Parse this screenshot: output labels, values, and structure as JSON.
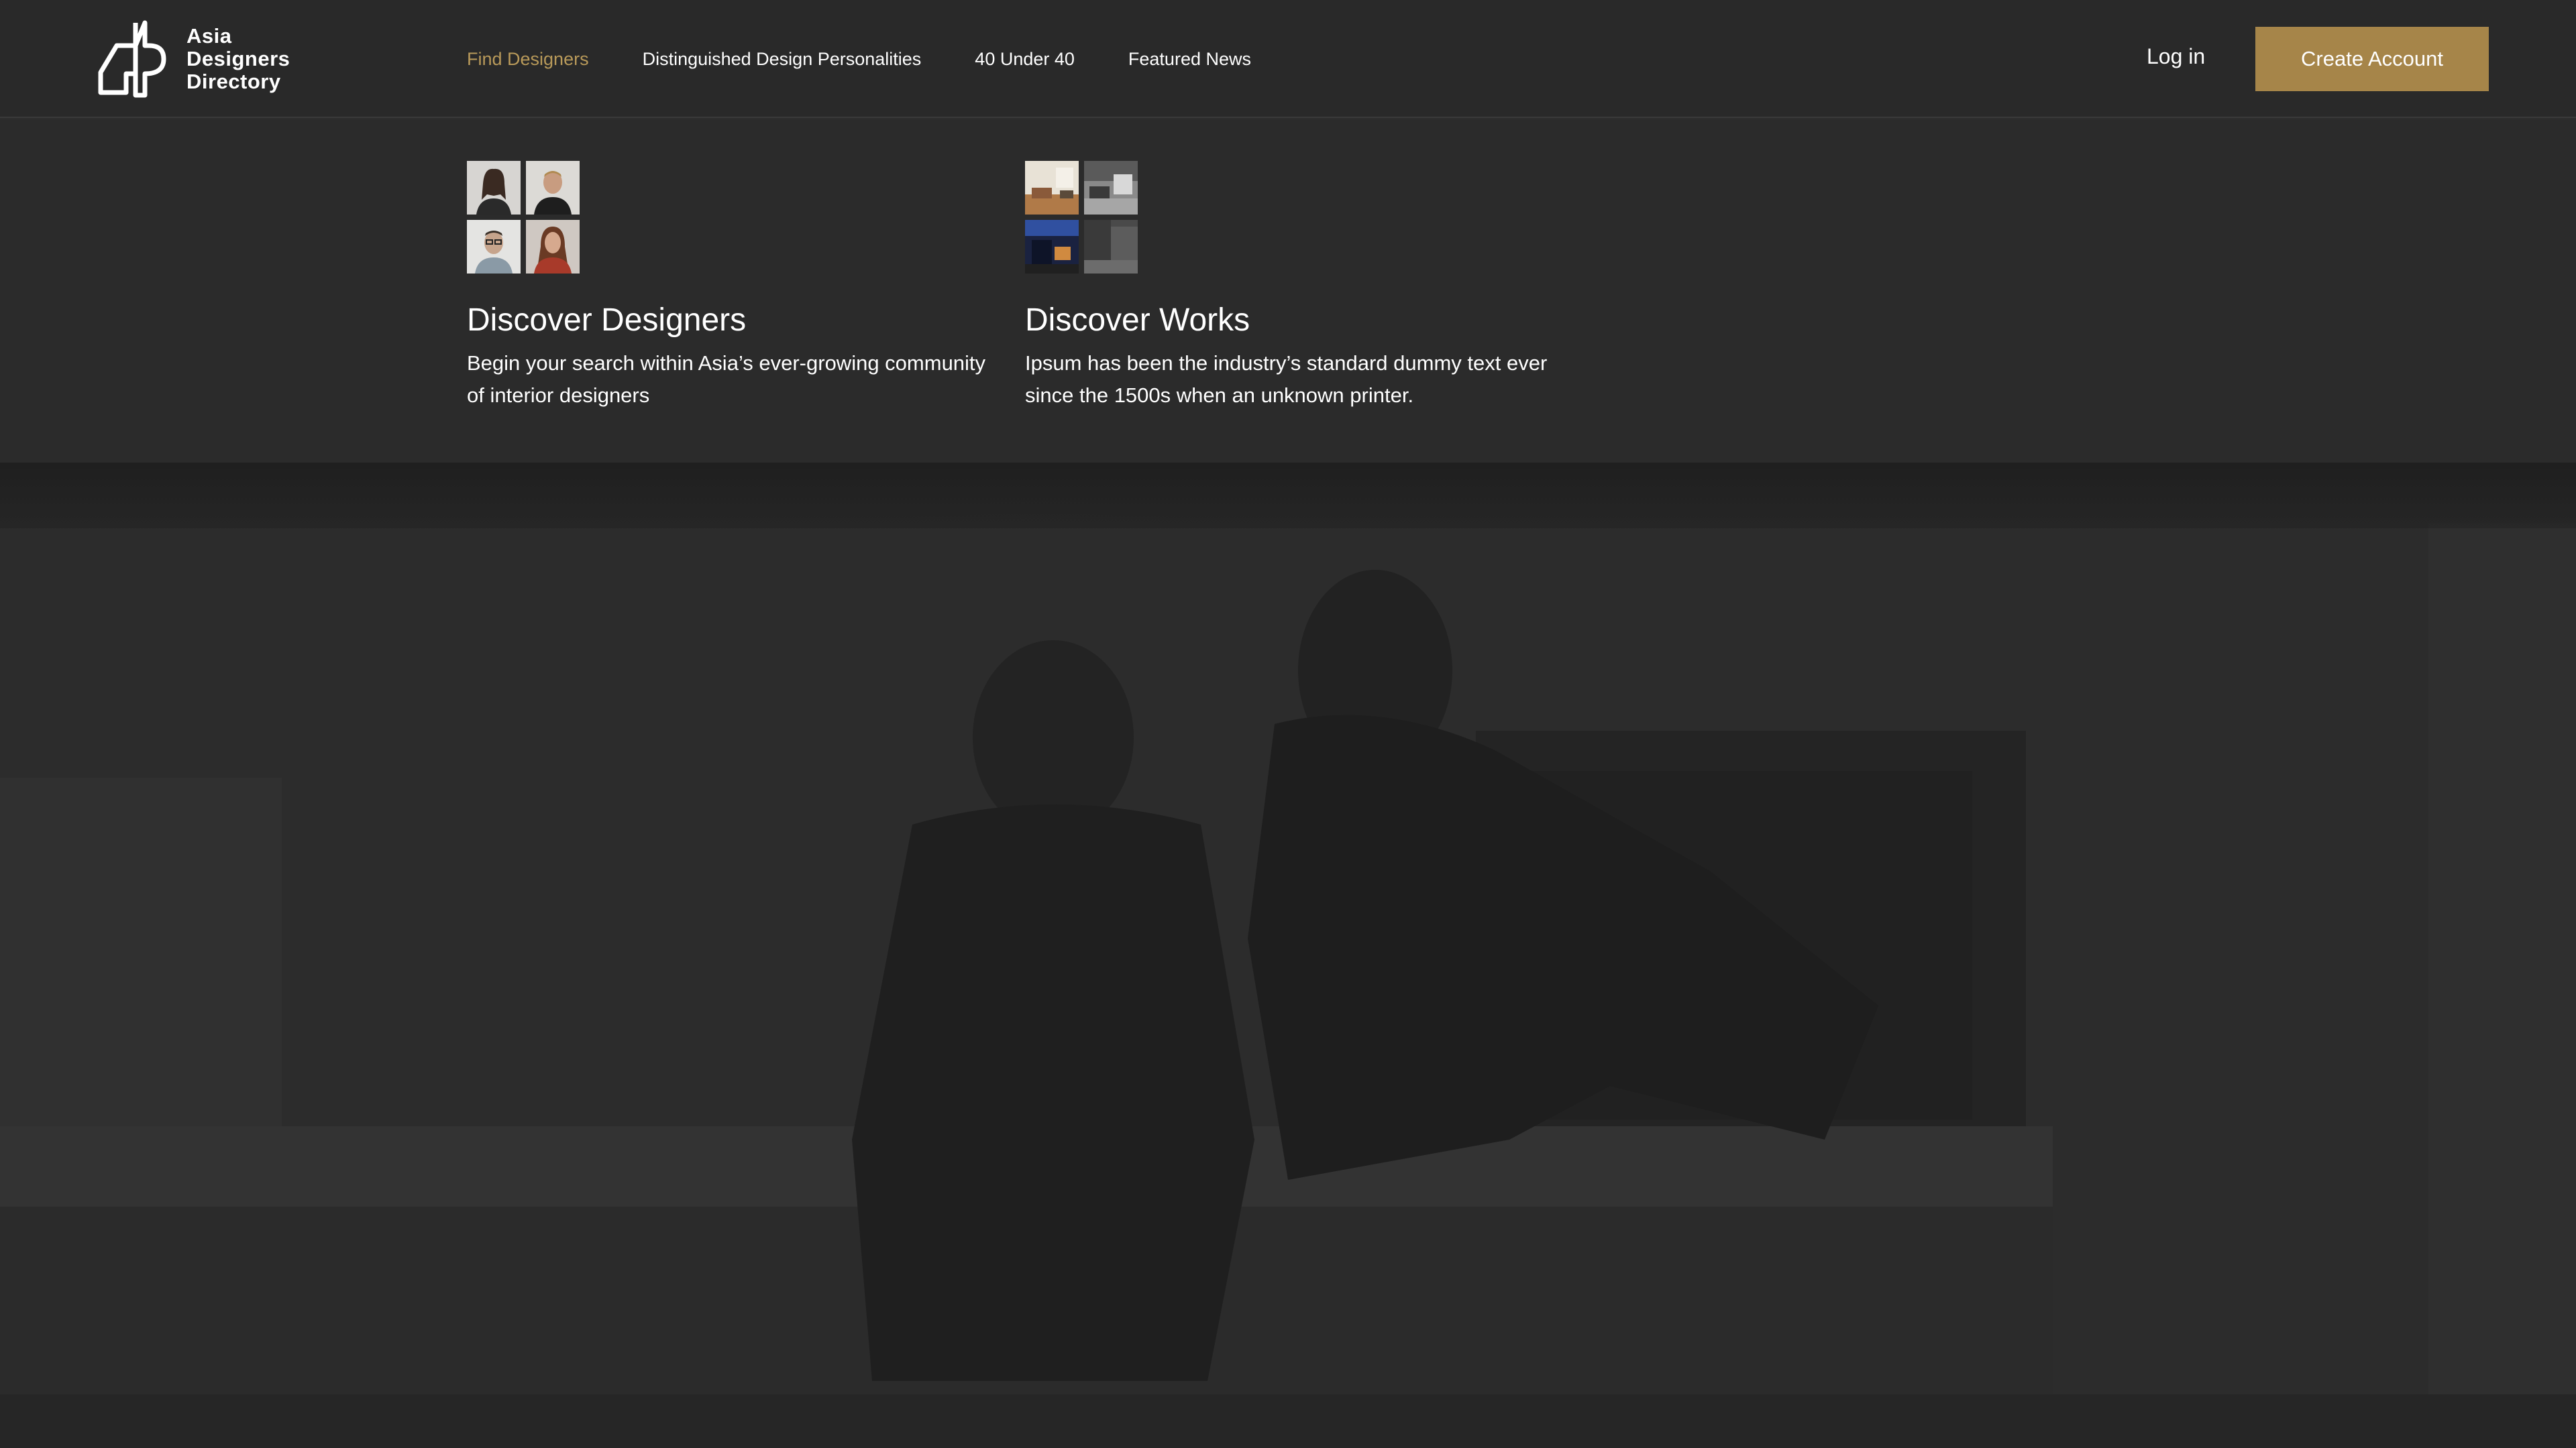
{
  "brand": {
    "line1": "Asia",
    "line2": "Designers",
    "line3": "Directory",
    "logo_icon": "adp-logo-icon"
  },
  "nav": {
    "items": [
      {
        "label": "Find Designers",
        "active": true
      },
      {
        "label": "Distinguished Design Personalities",
        "active": false
      },
      {
        "label": "40 Under 40",
        "active": false
      },
      {
        "label": "Featured News",
        "active": false
      }
    ]
  },
  "header_actions": {
    "login_label": "Log in",
    "create_account_label": "Create Account"
  },
  "mega_menu": {
    "cards": [
      {
        "title": "Discover Designers",
        "description": "Begin your search within Asia’s ever-growing community of interior designers"
      },
      {
        "title": "Discover Works",
        "description": "Ipsum has been the industry’s standard dummy text ever since the 1500s when an unknown printer."
      }
    ]
  },
  "colors": {
    "accent": "#a68549",
    "active_nav": "#b99a5a",
    "header_bg": "#292929",
    "text": "#ffffff"
  }
}
